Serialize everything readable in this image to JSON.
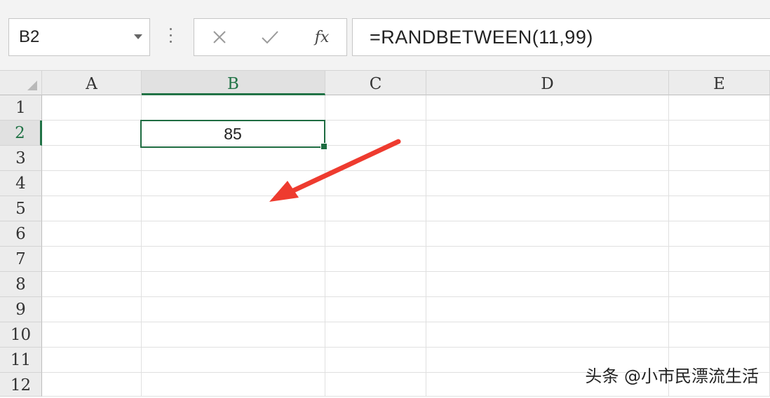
{
  "name_box": {
    "value": "B2"
  },
  "formula_bar": {
    "cancel_icon": "x-icon",
    "confirm_icon": "check-icon",
    "fx_label": "fx",
    "formula": "=RANDBETWEEN(11,99)"
  },
  "columns": [
    "A",
    "B",
    "C",
    "D",
    "E"
  ],
  "rows": [
    "1",
    "2",
    "3",
    "4",
    "5",
    "6",
    "7",
    "8",
    "9",
    "10",
    "11",
    "12"
  ],
  "selected_cell": {
    "column": "B",
    "row": "2",
    "value": "85"
  },
  "annotation": {
    "arrow": "red-arrow",
    "color": "#ee3b2f"
  },
  "watermark": "头条 @小市民漂流生活",
  "colors": {
    "accent": "#217346",
    "header_bg": "#ececec",
    "gridline": "#e0e0e0"
  }
}
